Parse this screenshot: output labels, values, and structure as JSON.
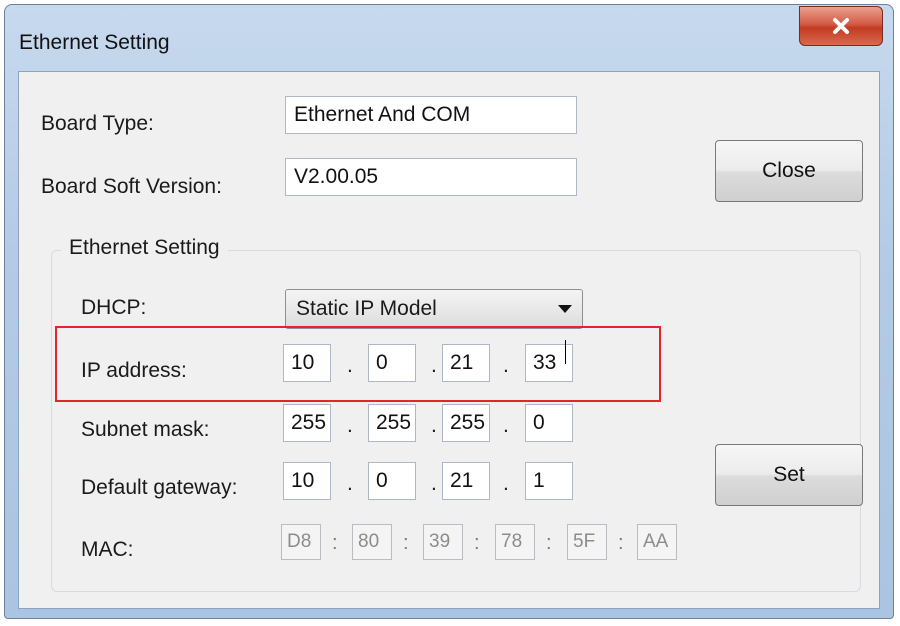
{
  "window": {
    "title": "Ethernet Setting",
    "close_glyph": "✕"
  },
  "board": {
    "type_label": "Board Type:",
    "type_value": "Ethernet And COM",
    "version_label": "Board Soft Version:",
    "version_value": "V2.00.05"
  },
  "buttons": {
    "close_label": "Close",
    "set_label": "Set"
  },
  "ethernet": {
    "group_caption": "Ethernet Setting",
    "dhcp_label": "DHCP:",
    "dhcp_value": "Static IP Model",
    "ip_label": "IP address:",
    "ip": [
      "10",
      "0",
      "21",
      "33"
    ],
    "subnet_label": "Subnet mask:",
    "subnet": [
      "255",
      "255",
      "255",
      "0"
    ],
    "gateway_label": "Default gateway:",
    "gateway": [
      "10",
      "0",
      "21",
      "1"
    ],
    "mac_label": "MAC:",
    "mac": [
      "D8",
      "80",
      "39",
      "78",
      "5F",
      "AA"
    ],
    "ip_separator": ".",
    "mac_separator": ":"
  },
  "colors": {
    "highlight": "#e3242b",
    "title_close": "#c23b22"
  },
  "icons": {
    "close": "close-icon",
    "dropdown": "chevron-down-icon"
  }
}
